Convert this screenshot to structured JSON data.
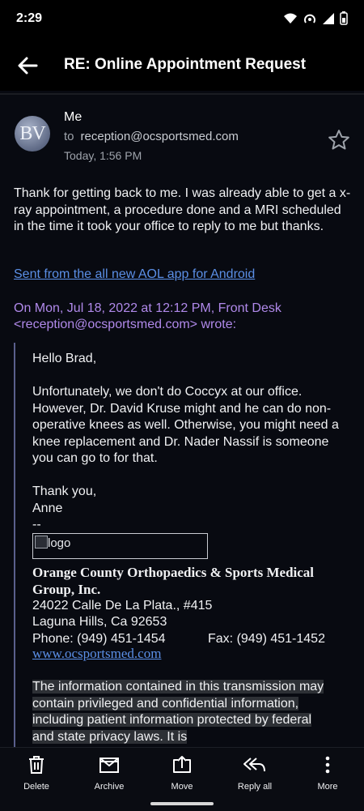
{
  "status_bar": {
    "time": "2:29"
  },
  "app_bar": {
    "title": "RE: Online Appointment Request"
  },
  "message": {
    "avatar_initials": "BV",
    "sender": "Me",
    "to_prefix": "to",
    "recipient": "reception@ocsportsmed.com",
    "date": "Today, 1:56 PM",
    "body": "Thank for getting back to me. I was already able to get a x-ray appointment, a procedure done and a MRI scheduled in the time it took your office to reply to me but thanks.",
    "signature_link": "Sent from the all new AOL app for Android",
    "quote_header": "On Mon, Jul 18, 2022 at 12:12 PM, Front Desk <reception@ocsportsmed.com> wrote:"
  },
  "quoted": {
    "greeting": "Hello Brad,",
    "paragraph": "Unfortunately, we don't do Coccyx at our office. However, Dr. David Kruse might and he can do non-operative knees as well. Otherwise, you might need a knee replacement and Dr. Nader Nassif is someone you can go to for that.",
    "thanks": "Thank you,",
    "name": "Anne",
    "dashes": "--",
    "logo_alt": "logo",
    "org_name": "Orange County Orthopaedics & Sports Medical Group, Inc.",
    "address1": "24022 Calle De La Plata., #415",
    "address2": "Laguna Hills, Ca 92653",
    "phone": "Phone: (949) 451-1454",
    "fax": "Fax: (949) 451-1452",
    "website": "www.ocsportsmed.com",
    "confidential": " The information contained in this transmission may contain privileged and confidential information, including patient information protected by federal and state privacy laws. It is"
  },
  "actions": [
    {
      "label": "Delete",
      "icon": "trash-icon"
    },
    {
      "label": "Archive",
      "icon": "archive-icon"
    },
    {
      "label": "Move",
      "icon": "move-icon"
    },
    {
      "label": "Reply all",
      "icon": "reply-all-icon"
    },
    {
      "label": "More",
      "icon": "more-vertical-icon"
    }
  ]
}
